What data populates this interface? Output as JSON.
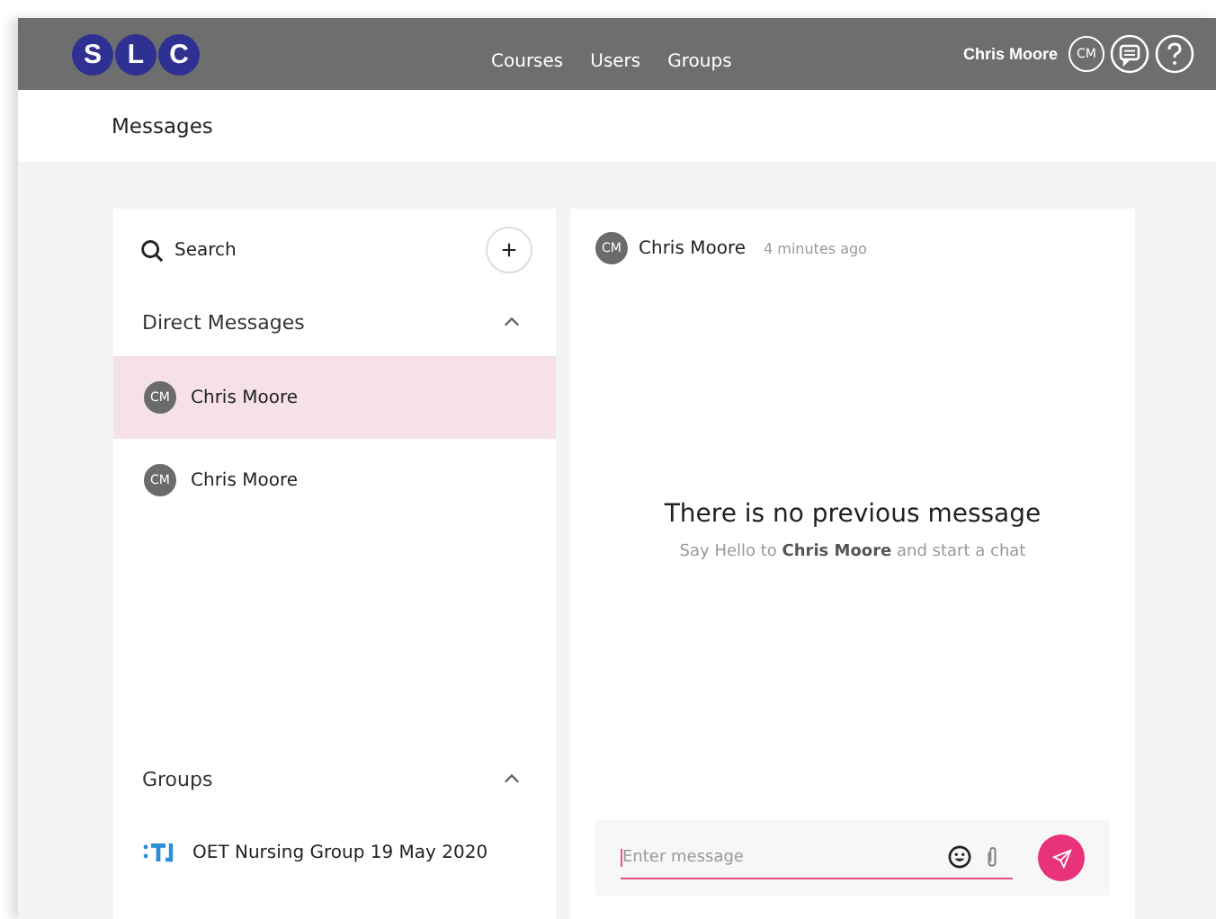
{
  "logo": {
    "letters": [
      "S",
      "L",
      "C"
    ]
  },
  "nav": [
    {
      "label": "Courses"
    },
    {
      "label": "Users"
    },
    {
      "label": "Groups"
    }
  ],
  "user": {
    "name": "Chris Moore",
    "initials": "CM"
  },
  "page_title": "Messages",
  "sidebar": {
    "search": {
      "placeholder": "Search"
    },
    "new_label": "+",
    "sections": [
      {
        "title": "Direct Messages",
        "expanded": true,
        "kind": "direct",
        "items": [
          {
            "initials": "CM",
            "name": "Chris Moore",
            "selected": true
          },
          {
            "initials": "CM",
            "name": "Chris Moore",
            "selected": false
          }
        ]
      },
      {
        "title": "Groups",
        "expanded": true,
        "kind": "group",
        "items": [
          {
            "name": "OET Nursing Group 19 May 2020",
            "selected": false
          }
        ]
      }
    ]
  },
  "chat": {
    "initials": "CM",
    "name": "Chris Moore",
    "time": "4 minutes ago",
    "empty_title": "There is no previous message",
    "empty_hint": "Say Hello to **Chris Moore** and start a chat",
    "input": {
      "placeholder": "Enter message"
    }
  }
}
